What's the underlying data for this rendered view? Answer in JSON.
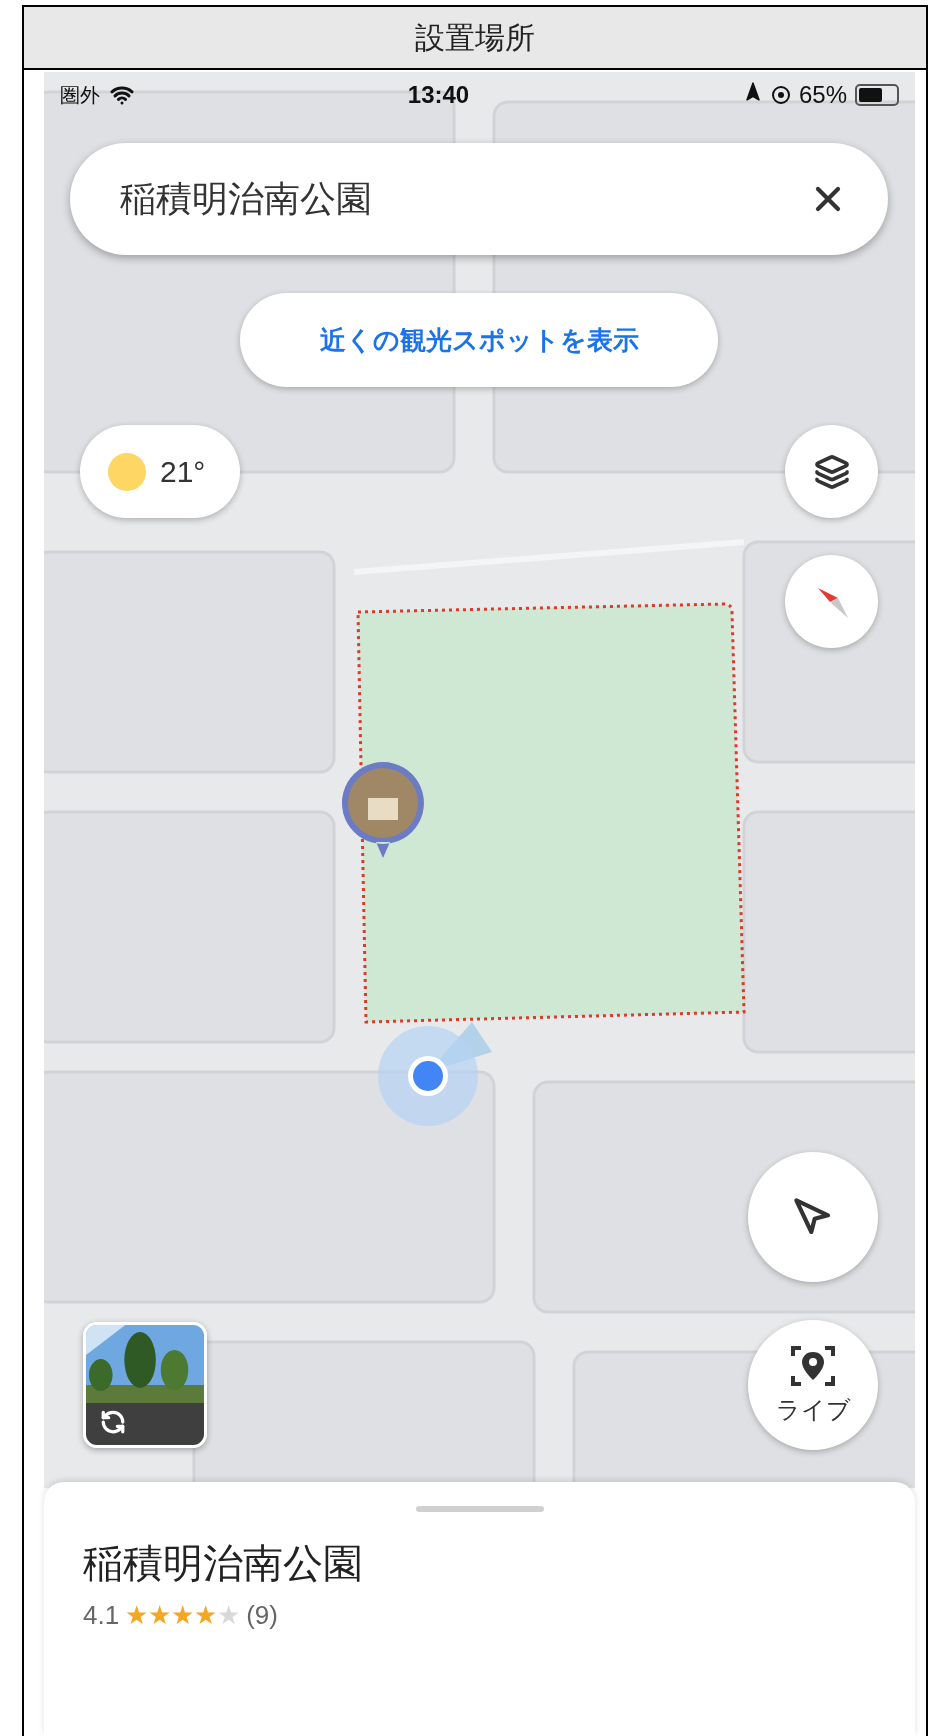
{
  "header": {
    "title": "設置場所"
  },
  "status_bar": {
    "carrier": "圏外",
    "time": "13:40",
    "battery": "65%"
  },
  "search": {
    "value": "稲積明治南公園"
  },
  "nearby_button": {
    "label": "近くの観光スポットを表示"
  },
  "weather": {
    "temperature": "21°"
  },
  "live_button": {
    "label": "ライブ"
  },
  "place": {
    "name": "稲積明治南公園",
    "rating": "4.1",
    "stars": 4,
    "review_count": "(9)"
  }
}
